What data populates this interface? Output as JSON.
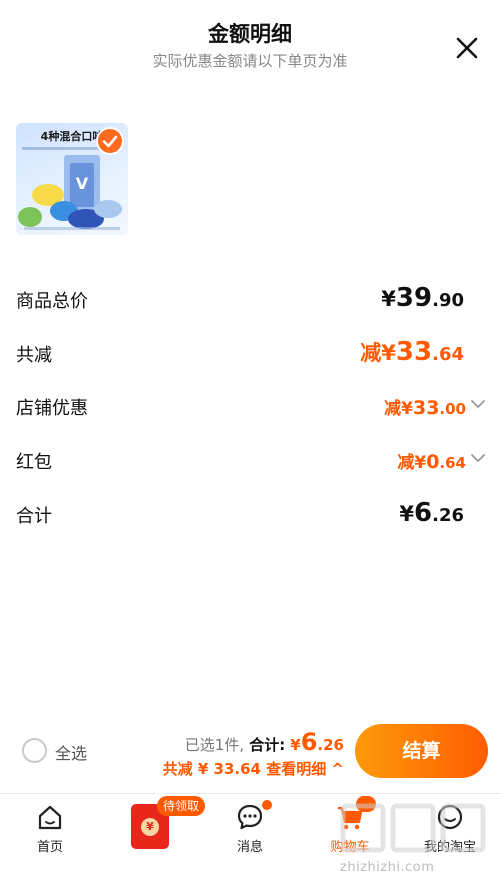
{
  "header": {
    "title": "金额明细",
    "subtitle": "实际优惠金额请以下单页为准"
  },
  "product": {
    "thumbnail_title": "4种混合口味"
  },
  "rows": [
    {
      "label": "商品总价",
      "yen": "¥",
      "amount_int": "39",
      "amount_dec": ".90",
      "prefix": "",
      "style": "dark",
      "has_chevron": false
    },
    {
      "label": "共减",
      "yen": "¥",
      "amount_int": "33",
      "amount_dec": ".64",
      "prefix": "减",
      "style": "orange",
      "has_chevron": false
    },
    {
      "label": "店铺优惠",
      "yen": "¥",
      "amount_int": "33",
      "amount_dec": ".00",
      "prefix": "减",
      "style": "orange",
      "has_chevron": true
    },
    {
      "label": "红包",
      "yen": "¥",
      "amount_int": "0",
      "amount_dec": ".64",
      "prefix": "减",
      "style": "orange",
      "has_chevron": true
    },
    {
      "label": "合计",
      "yen": "¥",
      "amount_int": "6",
      "amount_dec": ".26",
      "prefix": "",
      "style": "dark",
      "has_chevron": false
    }
  ],
  "bottom_bar": {
    "select_all_label": "全选",
    "selected_text": "已选1件,",
    "total_label": "合计:",
    "total_yen": "¥",
    "total_int": "6",
    "total_dec": ".26",
    "discount_text": "共减 ¥ 33.64",
    "view_details": "查看明细 ^",
    "checkout_label": "结算"
  },
  "tabbar": {
    "items": [
      {
        "label": "首页",
        "icon": "home-icon"
      },
      {
        "label": "",
        "icon": "red-packet-icon",
        "badge": "待领取"
      },
      {
        "label": "消息",
        "icon": "message-icon"
      },
      {
        "label": "购物车",
        "icon": "cart-icon"
      },
      {
        "label": "我的淘宝",
        "icon": "profile-icon"
      }
    ]
  },
  "watermark": "zhizhizhi.com",
  "colors": {
    "accent": "#ff5a00",
    "accent_light": "#ff9a0b",
    "red_packet": "#e8261a"
  }
}
